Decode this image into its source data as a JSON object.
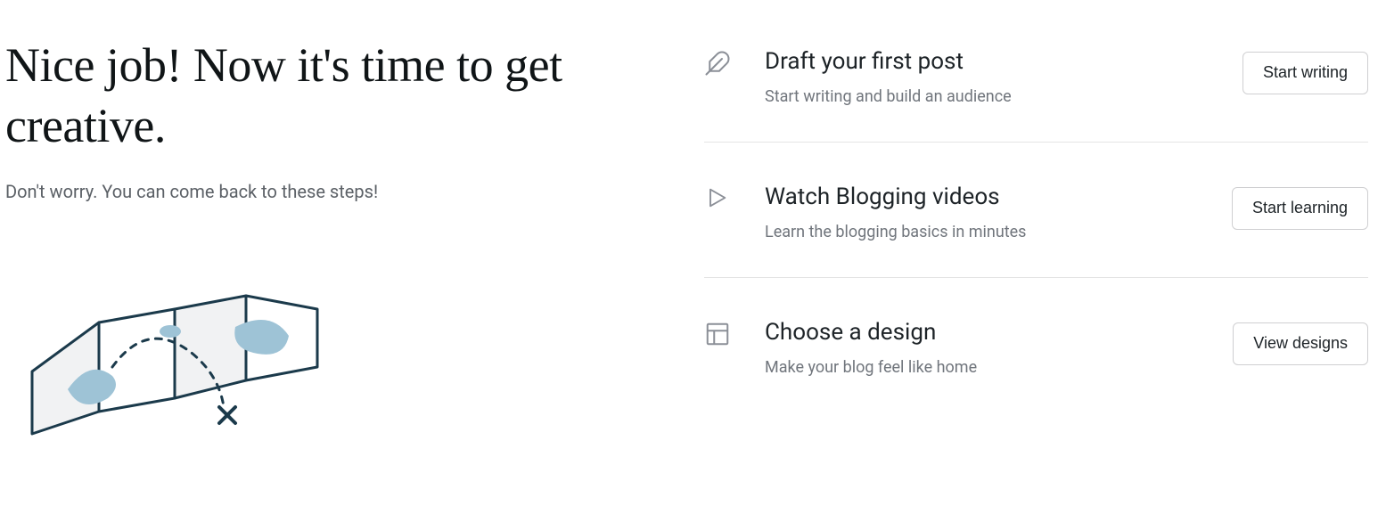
{
  "hero": {
    "title": "Nice job! Now it's time to get creative.",
    "subtitle": "Don't worry. You can come back to these steps!"
  },
  "tasks": [
    {
      "icon": "feather-icon",
      "title": "Draft your first post",
      "desc": "Start writing and build an audience",
      "button": "Start writing"
    },
    {
      "icon": "play-icon",
      "title": "Watch Blogging videos",
      "desc": "Learn the blogging basics in minutes",
      "button": "Start learning"
    },
    {
      "icon": "layout-icon",
      "title": "Choose a design",
      "desc": "Make your blog feel like home",
      "button": "View designs"
    }
  ]
}
